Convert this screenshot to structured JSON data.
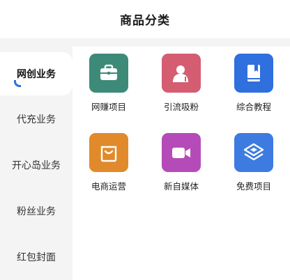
{
  "header": {
    "title": "商品分类"
  },
  "sidebar": {
    "items": [
      {
        "label": "网创业务",
        "active": true
      },
      {
        "label": "代充业务",
        "active": false
      },
      {
        "label": "开心岛业务",
        "active": false
      },
      {
        "label": "粉丝业务",
        "active": false
      },
      {
        "label": "红包封面",
        "active": false
      }
    ],
    "accent_color": "#2f6fde"
  },
  "categories": [
    {
      "label": "网赚项目",
      "icon": "briefcase-icon",
      "color": "#3e8a78"
    },
    {
      "label": "引流吸粉",
      "icon": "person-icon",
      "color": "#d45d72"
    },
    {
      "label": "综合教程",
      "icon": "book-icon",
      "color": "#2f6fde"
    },
    {
      "label": "电商运营",
      "icon": "shopping-bag-icon",
      "color": "#e08a2c"
    },
    {
      "label": "新自媒体",
      "icon": "video-camera-icon",
      "color": "#b54bb8"
    },
    {
      "label": "免费项目",
      "icon": "layers-icon",
      "color": "#3d7be0"
    }
  ]
}
